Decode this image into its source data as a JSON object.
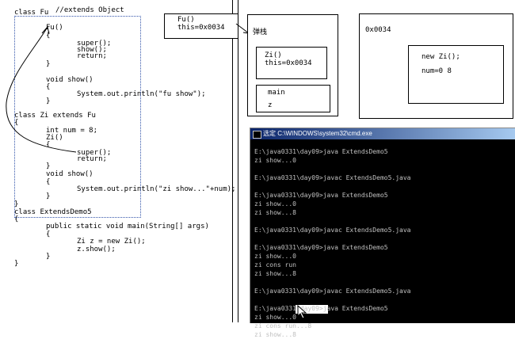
{
  "code": {
    "class_fu": "class Fu",
    "extends_comment": "//extends Object",
    "fu_ctor": "Fu()",
    "brace_open": "{",
    "brace_close": "}",
    "super_call": "super();",
    "show_call": "show();",
    "return_stmt": "return;",
    "void_show": "void show()",
    "println_fu": "System.out.println(\"fu show\");",
    "class_zi": "class Zi extends Fu",
    "int_num": "int num = 8;",
    "zi_ctor": "Zi()",
    "println_zi": "System.out.println(\"zi show...\"+num);",
    "class_demo": "class ExtendsDemo5",
    "main_sig": "public static void main(String[] args)",
    "zi_new": "Zi z = new Zi();",
    "z_show": "z.show();"
  },
  "memory": {
    "fu_frame": [
      "Fu()",
      "this=0x0034"
    ],
    "stack_label": "弹栈",
    "zi_frame": [
      "Zi()",
      "this=0x0034"
    ],
    "main_frame": [
      "main",
      "z"
    ],
    "heap_addr": "0x0034",
    "heap_obj": [
      "new Zi();",
      "num=0 8"
    ]
  },
  "cmd": {
    "title": "选定 C:\\WINDOWS\\system32\\cmd.exe",
    "lines": [
      "E:\\java0331\\day09>java ExtendsDemo5",
      "zi show...0",
      "",
      "E:\\java0331\\day09>javac ExtendsDemo5.java",
      "",
      "E:\\java0331\\day09>java ExtendsDemo5",
      "zi show...0",
      "zi show...8",
      "",
      "E:\\java0331\\day09>javac ExtendsDemo5.java",
      "",
      "E:\\java0331\\day09>java ExtendsDemo5",
      "zi show...0",
      "zi cons run",
      "zi show...8",
      "",
      "E:\\java0331\\day09>javac ExtendsDemo5.java",
      "",
      "E:\\java0331\\day09>java ExtendsDemo5",
      "zi show...0",
      "zi cons run...8",
      "zi show...8"
    ]
  }
}
